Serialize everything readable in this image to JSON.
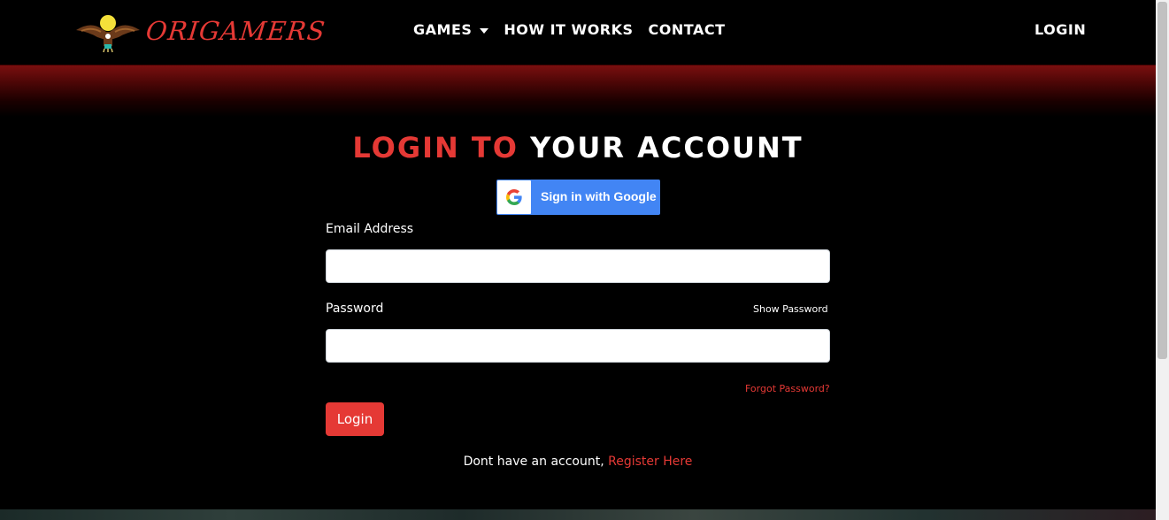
{
  "brand": {
    "name": "ORIGAMERS",
    "logo_icon": "eagle-logo-icon"
  },
  "nav": {
    "items": [
      {
        "label": "GAMES",
        "has_dropdown": true
      },
      {
        "label": "HOW IT WORKS"
      },
      {
        "label": "CONTACT"
      }
    ],
    "login_label": "LOGIN"
  },
  "heading": {
    "accent": "LOGIN TO",
    "rest": "YOUR ACCOUNT"
  },
  "google": {
    "label": "Sign in with Google",
    "icon": "google-g-icon"
  },
  "form": {
    "email_label": "Email Address",
    "email_value": "",
    "password_label": "Password",
    "password_value": "",
    "show_password": "Show Password",
    "forgot_password": "Forgot Password?",
    "login_button": "Login"
  },
  "register": {
    "text": "Dont have an account,",
    "link": "Register Here"
  },
  "colors": {
    "accent": "#e53935",
    "background": "#000000",
    "google_blue": "#4285f4"
  }
}
